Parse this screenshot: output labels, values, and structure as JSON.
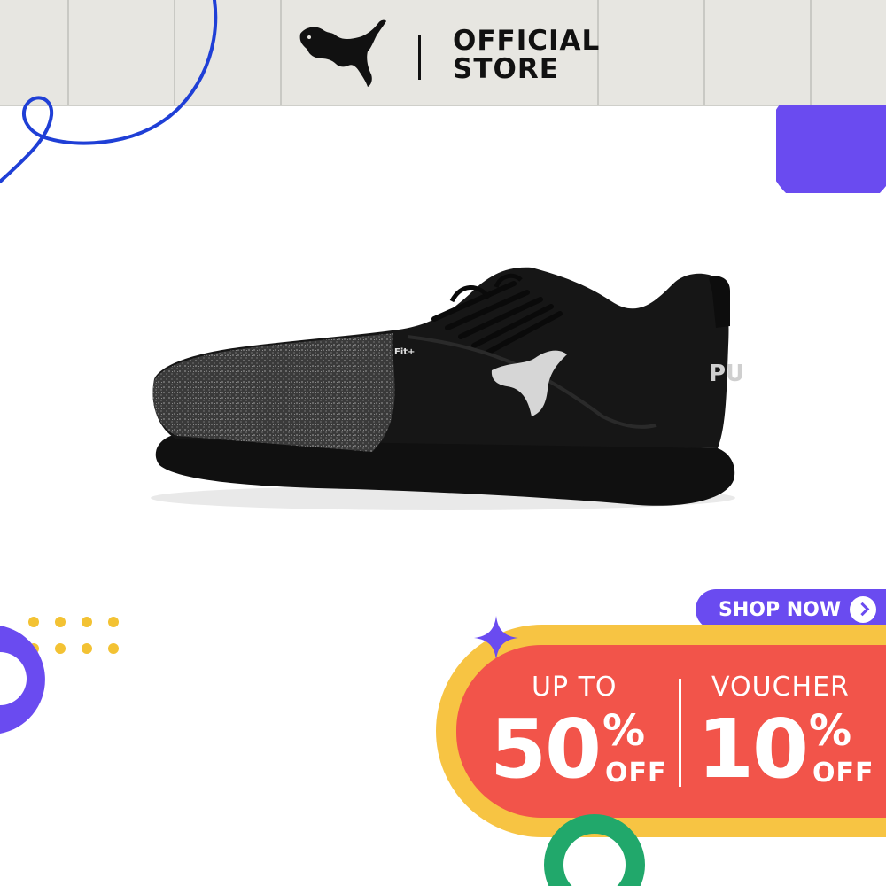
{
  "header": {
    "brand": "PUMA",
    "store_line1": "OFFICIAL",
    "store_line2": "STORE"
  },
  "product": {
    "shoe_tag": "Fit+",
    "heel_text": "PU"
  },
  "cta": {
    "label": "SHOP NOW"
  },
  "promo": {
    "left": {
      "label": "UP TO",
      "value": "50",
      "percent": "%",
      "suffix": "OFF"
    },
    "right": {
      "label": "VOUCHER",
      "value": "10",
      "percent": "%",
      "suffix": "OFF"
    }
  },
  "colors": {
    "header_bg": "#e7e6e1",
    "purple": "#6a4bf0",
    "blue_line": "#1f3fd6",
    "promo_red": "#f2544a",
    "promo_yellow": "#f7c443",
    "green_ring": "#21a86b",
    "dot_yellow": "#f3c233"
  }
}
